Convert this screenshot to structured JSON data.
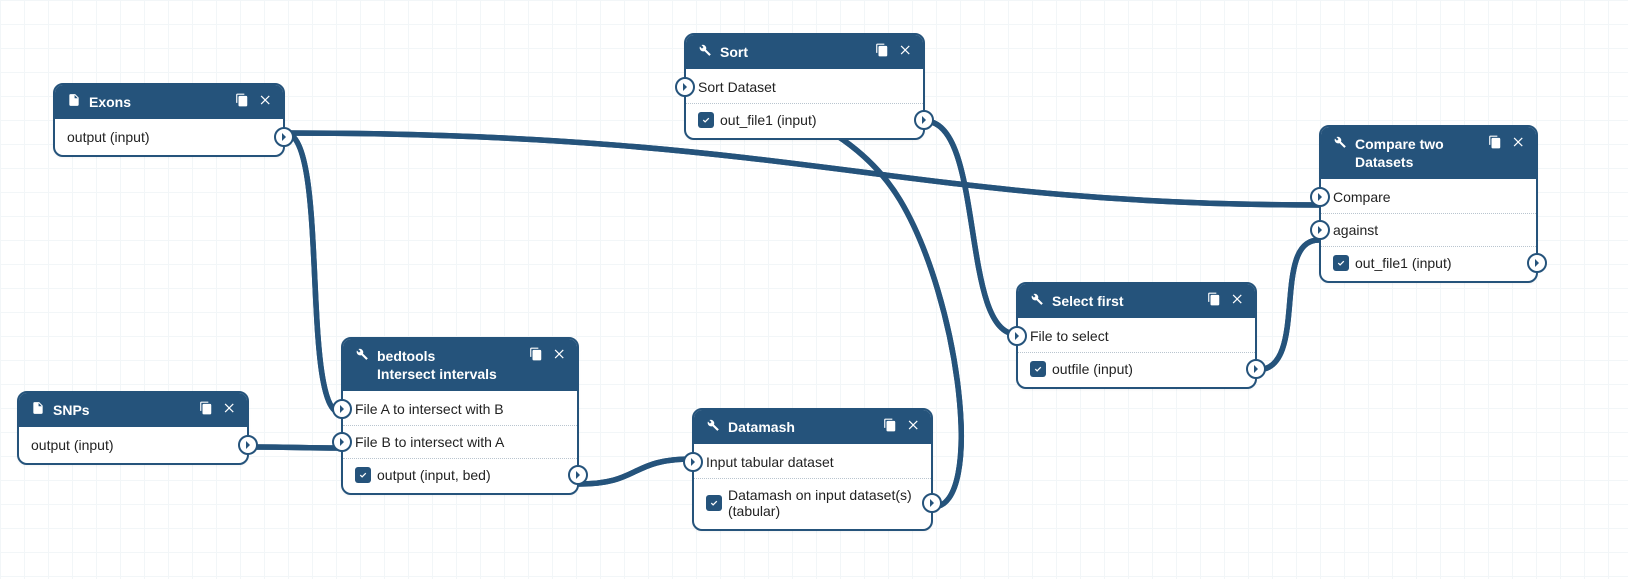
{
  "colors": {
    "accent": "#25537b"
  },
  "nodes": {
    "exons": {
      "kind": "data-input",
      "title": "Exons",
      "outputs": [
        {
          "label": "output (input)"
        }
      ]
    },
    "snps": {
      "kind": "data-input",
      "title": "SNPs",
      "outputs": [
        {
          "label": "output (input)"
        }
      ]
    },
    "bedtools": {
      "kind": "tool",
      "title": "bedtools",
      "subtitle": "Intersect intervals",
      "inputs": [
        {
          "label": "File A to intersect with B"
        },
        {
          "label": "File B to intersect with A"
        }
      ],
      "outputs": [
        {
          "label": "output (input, bed)"
        }
      ]
    },
    "datamash": {
      "kind": "tool",
      "title": "Datamash",
      "inputs": [
        {
          "label": "Input tabular dataset"
        }
      ],
      "outputs": [
        {
          "label": "Datamash on input dataset(s) (tabular)"
        }
      ]
    },
    "sort": {
      "kind": "tool",
      "title": "Sort",
      "inputs": [
        {
          "label": "Sort Dataset"
        }
      ],
      "outputs": [
        {
          "label": "out_file1 (input)"
        }
      ]
    },
    "select_first": {
      "kind": "tool",
      "title": "Select first",
      "inputs": [
        {
          "label": "File to select"
        }
      ],
      "outputs": [
        {
          "label": "outfile (input)"
        }
      ]
    },
    "compare": {
      "kind": "tool",
      "title": "Compare two Datasets",
      "inputs": [
        {
          "label": "Compare"
        },
        {
          "label": "against"
        }
      ],
      "outputs": [
        {
          "label": "out_file1 (input)"
        }
      ]
    }
  },
  "edges": [
    {
      "from": "exons.output",
      "to": "bedtools.fileA"
    },
    {
      "from": "exons.output",
      "to": "compare.compare"
    },
    {
      "from": "snps.output",
      "to": "bedtools.fileB"
    },
    {
      "from": "bedtools.output",
      "to": "datamash.input"
    },
    {
      "from": "datamash.output",
      "to": "sort.input"
    },
    {
      "from": "sort.out_file1",
      "to": "select_first.input"
    },
    {
      "from": "select_first.outfile",
      "to": "compare.against"
    }
  ]
}
